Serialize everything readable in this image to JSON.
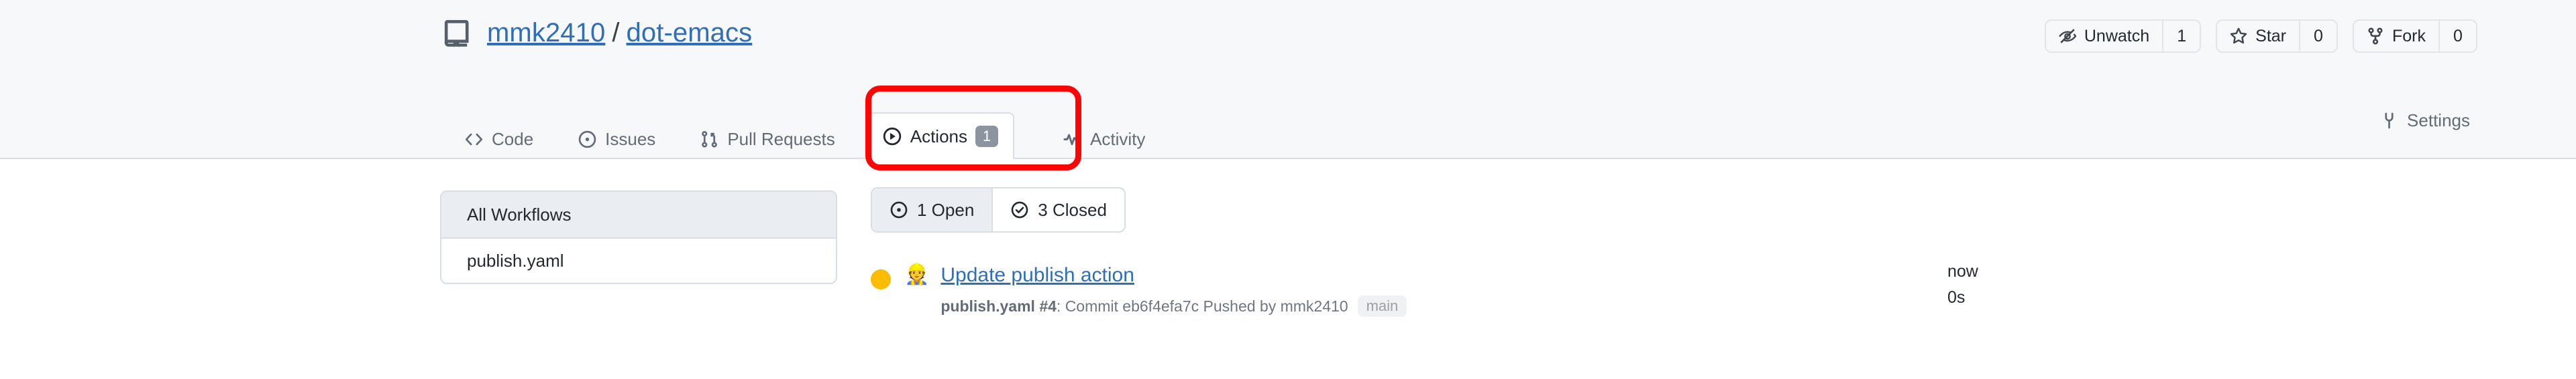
{
  "repo": {
    "icon": "repo-icon",
    "owner": "mmk2410",
    "separator": "/",
    "name": "dot-emacs"
  },
  "repo_actions": [
    {
      "icon": "eye-closed-icon",
      "label": "Unwatch",
      "count": "1"
    },
    {
      "icon": "star-icon",
      "label": "Star",
      "count": "0"
    },
    {
      "icon": "fork-icon",
      "label": "Fork",
      "count": "0"
    }
  ],
  "nav": {
    "items": [
      {
        "icon": "code-icon",
        "label": "Code",
        "badge": "",
        "selected": false
      },
      {
        "icon": "issue-opened-icon",
        "label": "Issues",
        "badge": "",
        "selected": false
      },
      {
        "icon": "git-pull-request-icon",
        "label": "Pull Requests",
        "badge": "",
        "selected": false
      },
      {
        "icon": "play-icon",
        "label": "Actions",
        "badge": "1",
        "selected": true
      },
      {
        "icon": "pulse-icon",
        "label": "Activity",
        "badge": "",
        "selected": false
      }
    ],
    "settings": {
      "icon": "gear-icon",
      "label": "Settings"
    }
  },
  "annotation": {
    "shape": "rounded-rect",
    "color": "#fb0505",
    "target": "actions-tab"
  },
  "sidebar": {
    "items": [
      {
        "label": "All Workflows",
        "selected": true
      },
      {
        "label": "publish.yaml",
        "selected": false
      }
    ]
  },
  "filters": [
    {
      "icon": "issue-opened-icon",
      "label": "1 Open",
      "selected": true
    },
    {
      "icon": "check-circle-icon",
      "label": "3 Closed",
      "selected": false
    }
  ],
  "runs": [
    {
      "status": "in-progress",
      "status_color": "#fcbc00",
      "emoji": "👷",
      "title": "Update publish action",
      "workflow_ref": "publish.yaml #4",
      "meta_text": ": Commit eb6f4efa7c Pushed by mmk2410",
      "branch": "main",
      "relative_time": "now",
      "duration": "0s"
    }
  ],
  "colors": {
    "link": "#2f6ebb",
    "header_bg": "#f6f8fa",
    "border": "#d8dee4",
    "badge_bg": "#8c959f",
    "status_yellow": "#fcbc00",
    "annotation_red": "#fb0505"
  }
}
